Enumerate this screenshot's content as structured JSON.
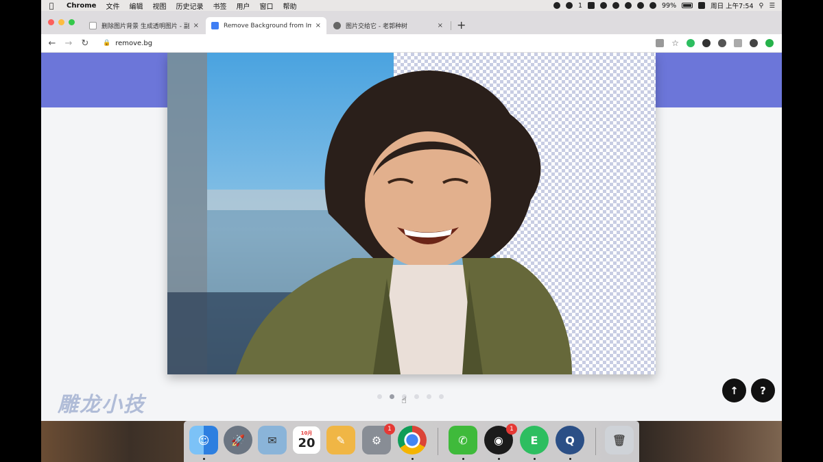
{
  "menubar": {
    "app": "Chrome",
    "items": [
      "文件",
      "编辑",
      "视图",
      "历史记录",
      "书签",
      "用户",
      "窗口",
      "帮助"
    ],
    "battery": "99%",
    "clock": "周日 上午7:54",
    "notif_count": "1"
  },
  "tabs": [
    {
      "title": "删除图片背景 生成透明图片 - 副",
      "favicon_color": "#ffffff",
      "close": "×"
    },
    {
      "title": "Remove Background from Ima",
      "favicon_color": "#3f7ef4",
      "close": "×"
    },
    {
      "title": "图片交给它 - 老郭种树",
      "favicon_color": "#666666",
      "close": "×"
    }
  ],
  "new_tab": "+",
  "address": {
    "url": "remove.bg"
  },
  "page": {
    "watermark": "雕龙小技",
    "carousel_dots": 6,
    "active_dot": 1,
    "scroll_top_label": "↑",
    "help_label": "?"
  },
  "dock": [
    {
      "name": "finder",
      "label": "☺",
      "color": "#4fa3f7",
      "running": true
    },
    {
      "name": "launchpad",
      "label": "🚀",
      "color": "#6b7582",
      "running": false
    },
    {
      "name": "preview",
      "label": "✉",
      "color": "#8ab4d9",
      "running": false
    },
    {
      "name": "calendar",
      "label": "20",
      "month": "10月",
      "color": "#ffffff",
      "running": false
    },
    {
      "name": "pages",
      "label": "✎",
      "color": "#f0b645",
      "running": false
    },
    {
      "name": "system-preferences",
      "label": "⚙",
      "color": "#888d95",
      "running": false,
      "badge": "1"
    },
    {
      "name": "chrome",
      "label": "●",
      "color": "#db4437",
      "running": true
    },
    {
      "name": "wechat",
      "label": "✆",
      "color": "#3fba3b",
      "running": true
    },
    {
      "name": "qq",
      "label": "◉",
      "color": "#1b1b1b",
      "running": true,
      "badge": "1"
    },
    {
      "name": "evernote",
      "label": "E",
      "color": "#2dbe60",
      "running": true
    },
    {
      "name": "quicktime",
      "label": "Q",
      "color": "#2b4f86",
      "running": true
    },
    {
      "name": "trash",
      "label": "🗑",
      "color": "#cfd3d8",
      "running": false
    }
  ],
  "colors": {
    "header_band": "#6c76d9",
    "checker": "#c8cde3",
    "active_tab_favicon": "#3f7ef4"
  }
}
